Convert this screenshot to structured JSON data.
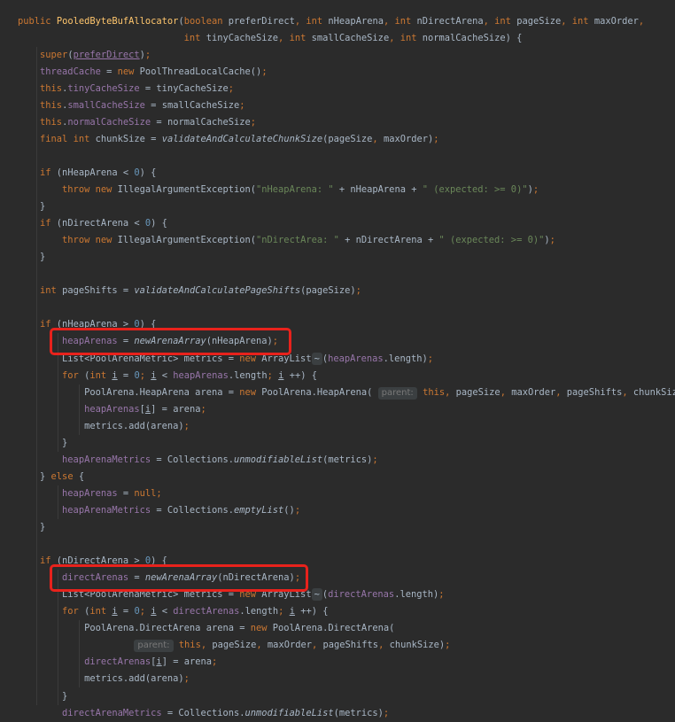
{
  "lines": [
    "public PooledByteBufAllocator(boolean preferDirect, int nHeapArena, int nDirectArena, int pageSize, int maxOrder,",
    "                              int tinyCacheSize, int smallCacheSize, int normalCacheSize) {",
    "    super(preferDirect);",
    "    threadCache = new PoolThreadLocalCache();",
    "    this.tinyCacheSize = tinyCacheSize;",
    "    this.smallCacheSize = smallCacheSize;",
    "    this.normalCacheSize = normalCacheSize;",
    "    final int chunkSize = validateAndCalculateChunkSize(pageSize, maxOrder);",
    "",
    "    if (nHeapArena < 0) {",
    "        throw new IllegalArgumentException(\"nHeapArena: \" + nHeapArena + \" (expected: >= 0)\");",
    "    }",
    "    if (nDirectArena < 0) {",
    "        throw new IllegalArgumentException(\"nDirectArea: \" + nDirectArena + \" (expected: >= 0)\");",
    "    }",
    "",
    "    int pageShifts = validateAndCalculatePageShifts(pageSize);",
    "",
    "    if (nHeapArena > 0) {",
    "        heapArenas = newArenaArray(nHeapArena);",
    "        List<PoolArenaMetric> metrics = new ArrayList<~>(heapArenas.length);",
    "        for (int i = 0; i < heapArenas.length; i ++) {",
    "            PoolArena.HeapArena arena = new PoolArena.HeapArena( parent: this, pageSize, maxOrder, pageShifts, chunkSize);",
    "            heapArenas[i] = arena;",
    "            metrics.add(arena);",
    "        }",
    "        heapArenaMetrics = Collections.unmodifiableList(metrics);",
    "    } else {",
    "        heapArenas = null;",
    "        heapArenaMetrics = Collections.emptyList();",
    "    }",
    "",
    "    if (nDirectArena > 0) {",
    "        directArenas = newArenaArray(nDirectArena);",
    "        List<PoolArenaMetric> metrics = new ArrayList<~>(directArenas.length);",
    "        for (int i = 0; i < directArenas.length; i ++) {",
    "            PoolArena.DirectArena arena = new PoolArena.DirectArena(",
    "                     parent: this, pageSize, maxOrder, pageShifts, chunkSize);",
    "            directArenas[i] = arena;",
    "            metrics.add(arena);",
    "        }",
    "        directArenaMetrics = Collections.unmodifiableList(metrics);"
  ],
  "hint_parent": "parent:",
  "diamond": "<~>",
  "highlight_color": "#e8221c"
}
